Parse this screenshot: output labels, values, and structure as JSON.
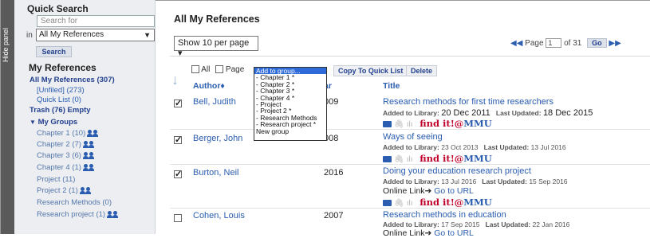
{
  "hide_panel": "Hide panel",
  "quick_search": {
    "title": "Quick Search",
    "placeholder": "Search for",
    "in_label": "in",
    "scope": "All My References",
    "button": "Search"
  },
  "my_references": {
    "title": "My References",
    "all": "All My References (307)",
    "unfiled": "[Unfiled] (273)",
    "quick_list": "Quick List (0)",
    "trash": "Trash (76)",
    "empty": "Empty",
    "groups_label": "My Groups",
    "groups": [
      "Chapter 1 (10)",
      "Chapter 2 (7)",
      "Chapter 3 (6)",
      "Chapter 4 (1)",
      "Project (11)",
      "Project 2 (1)",
      "Research Methods (0)",
      "Research project (1)"
    ]
  },
  "main": {
    "title": "All My References",
    "per_page": "Show 10 per page",
    "pager": {
      "page_label": "Page",
      "page_value": "1",
      "of": "of 31",
      "go": "Go"
    },
    "select_all": "All",
    "select_page": "Page",
    "copy_btn": "Copy To Quick List",
    "delete_btn": "Delete",
    "headers": {
      "author": "Author",
      "year": "ar",
      "title": "Title"
    }
  },
  "dropdown": {
    "options": [
      "Add to group...",
      "- Chapter 1 *",
      "- Chapter 2 *",
      "- Chapter 3 *",
      "- Chapter 4 *",
      "- Project",
      "- Project 2 *",
      "- Research Methods",
      "- Research project *",
      "New group"
    ]
  },
  "rows": [
    {
      "author": "Bell, Judith",
      "year": "009",
      "title": "Research methods for first time researchers",
      "added_label": "Added to Library:",
      "added": "20 Dec 2011",
      "updated_label": "Last Updated:",
      "updated": "18 Dec 2015",
      "online": "",
      "find_it": "find it!",
      "find_mmu": "MMU"
    },
    {
      "author": "Berger, John",
      "year": "008",
      "title": "Ways of seeing",
      "added_label": "Added to Library:",
      "added": "23 Oct 2013",
      "updated_label": "Last Updated:",
      "updated": "13 Jul 2016",
      "online": "",
      "find_it": "find it!",
      "find_mmu": "MMU"
    },
    {
      "author": "Burton, Neil",
      "year": "2016",
      "title": "Doing your education research project",
      "added_label": "Added to Library:",
      "added": "13 Jul 2016",
      "updated_label": "Last Updated:",
      "updated": "15 Sep 2016",
      "online": "Online Link",
      "online_go": "Go to URL",
      "find_it": "find it!",
      "find_mmu": "MMU"
    },
    {
      "author": "Cohen, Louis",
      "year": "2007",
      "title": "Research methods in education",
      "added_label": "Added to Library:",
      "added": "17 Sep 2015",
      "updated_label": "Last Updated:",
      "updated": "22 Jan 2016",
      "online": "Online Link",
      "online_go": "Go to URL"
    }
  ]
}
